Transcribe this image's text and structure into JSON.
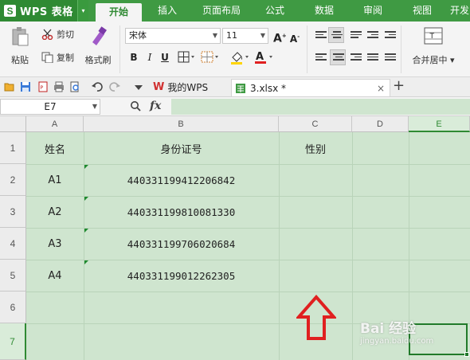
{
  "app": {
    "logo": "S",
    "name": "WPS 表格",
    "menu_arrow": "▾"
  },
  "ribbon_tabs": [
    "开始",
    "插入",
    "页面布局",
    "公式",
    "数据",
    "审阅",
    "视图",
    "开发"
  ],
  "active_tab": "开始",
  "clipboard": {
    "paste": "粘贴",
    "cut": "剪切",
    "copy": "复制",
    "format_painter": "格式刷"
  },
  "font": {
    "name": "宋体",
    "size": "11",
    "bold": "B",
    "italic": "I",
    "underline": "U"
  },
  "merge": {
    "label": "合并居中"
  },
  "doc_tabs": [
    {
      "label": "我的WPS"
    },
    {
      "label": "3.xlsx *",
      "close": "×"
    }
  ],
  "new_tab": "+",
  "formula_bar": {
    "name_box": "E7",
    "fx": "fx",
    "content": ""
  },
  "sheet": {
    "columns": [
      "A",
      "B",
      "C",
      "D",
      "E"
    ],
    "rows": [
      "1",
      "2",
      "3",
      "4",
      "5",
      "6",
      "7"
    ],
    "selected_cell": "E7",
    "cells": {
      "A1": "姓名",
      "B1": "身份证号",
      "C1": "性别",
      "A2": "A1",
      "B2": "440331199412206842",
      "A3": "A2",
      "B3": "440331199810081330",
      "A4": "A3",
      "B4": "440331199706020684",
      "A5": "A4",
      "B5": "440331199012262305"
    }
  },
  "annotation": {
    "arrow": "red-up-arrow",
    "color": "#e02020"
  },
  "watermark": {
    "line1": "Bai 经验",
    "line2": "jingyan.baidu.com"
  },
  "colors": {
    "brand_green": "#3f9a43",
    "sheet_bg": "#cfe5cf",
    "selection": "#217a2a"
  }
}
